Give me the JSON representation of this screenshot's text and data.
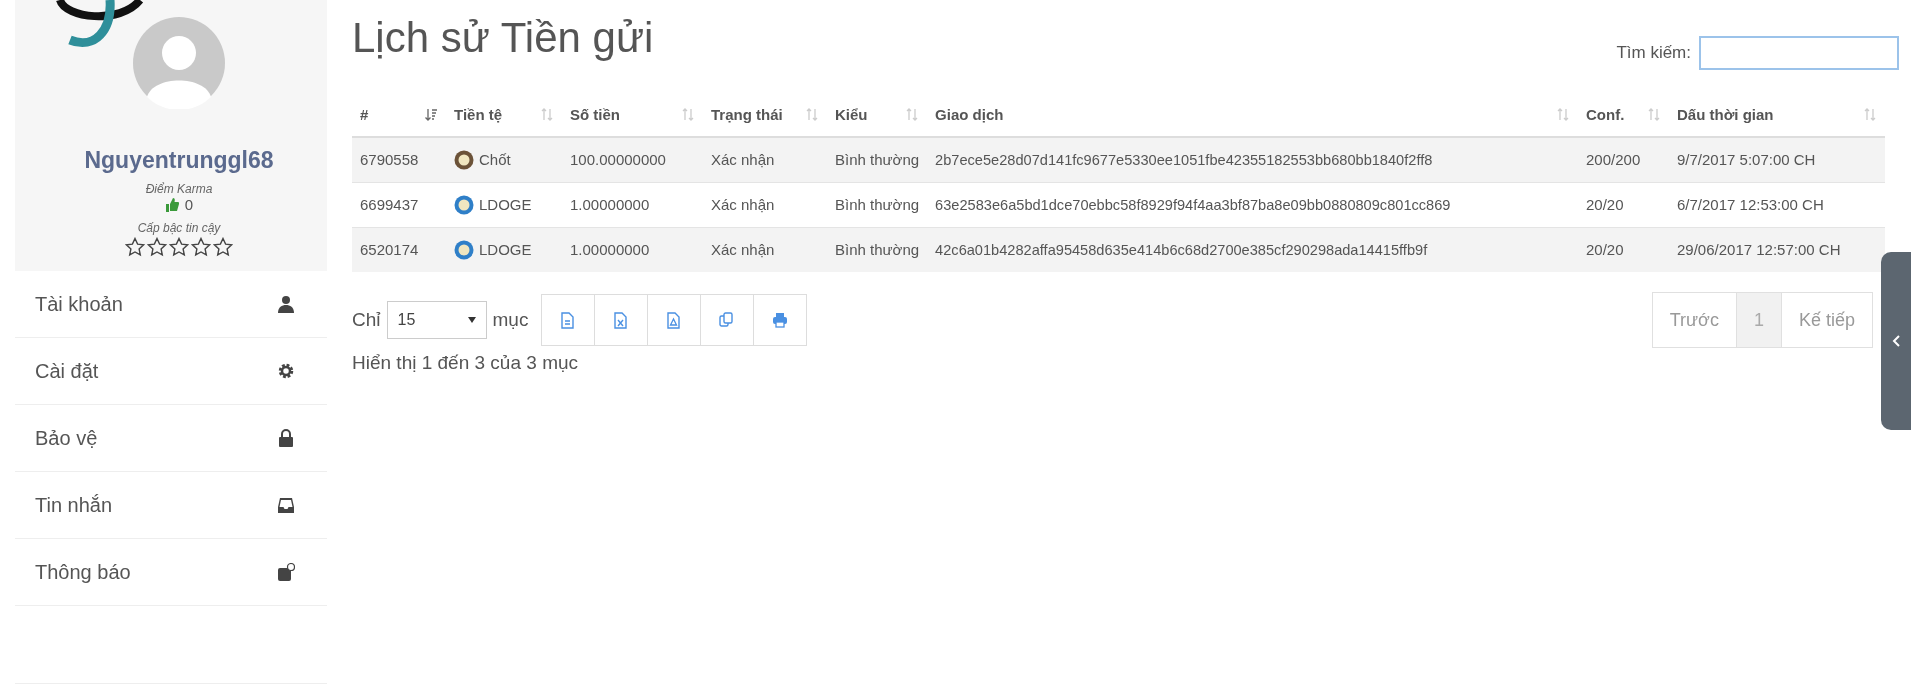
{
  "profile": {
    "username": "Nguyentrunggl68",
    "karma_label": "Điểm Karma",
    "karma_value": "0",
    "trust_label": "Cấp bậc tin cậy",
    "stars": 0
  },
  "sidebar": {
    "items": [
      {
        "label": "Tài khoản",
        "kind": "user"
      },
      {
        "label": "Cài đặt",
        "kind": "gear"
      },
      {
        "label": "Bảo vệ",
        "kind": "lock"
      },
      {
        "label": "Tin nhắn",
        "kind": "inbox"
      },
      {
        "label": "Thông báo",
        "kind": "bell"
      }
    ]
  },
  "page_title": "Lịch sử Tiền gửi",
  "search": {
    "label": "Tìm kiếm:"
  },
  "table": {
    "columns": [
      {
        "label": "#",
        "sorted": true
      },
      {
        "label": "Tiền tệ",
        "sorted": false
      },
      {
        "label": "Số tiền",
        "sorted": false
      },
      {
        "label": "Trạng thái",
        "sorted": false
      },
      {
        "label": "Kiểu",
        "sorted": false
      },
      {
        "label": "Giao dịch",
        "sorted": false
      },
      {
        "label": "Conf.",
        "sorted": false
      },
      {
        "label": "Dấu thời gian",
        "sorted": false
      }
    ],
    "rows": [
      {
        "id": "6790558",
        "currency": "Chốt",
        "color": "#6b5238",
        "amount": "100.00000000",
        "status": "Xác nhận",
        "type": "Bình thường",
        "tx": "2b7ece5e28d07d141fc9677e5330ee1051fbe42355182553bb680bb1840f2ff8",
        "conf": "200/200",
        "time": "9/7/2017 5:07:00 CH"
      },
      {
        "id": "6699437",
        "currency": "LDOGE",
        "color": "#2f7fc8",
        "amount": "1.00000000",
        "status": "Xác nhận",
        "type": "Bình thường",
        "tx": "63e2583e6a5bd1dce70ebbc58f8929f94f4aa3bf87ba8e09bb0880809c801cc869",
        "conf": "20/20",
        "time": "6/7/2017 12:53:00 CH"
      },
      {
        "id": "6520174",
        "currency": "LDOGE",
        "color": "#2f7fc8",
        "amount": "1.00000000",
        "status": "Xác nhận",
        "type": "Bình thường",
        "tx": "42c6a01b4282affa95458d635e414b6c68d2700e385cf290298ada14415ffb9f",
        "conf": "20/20",
        "time": "29/06/2017 12:57:00 CH"
      }
    ]
  },
  "length": {
    "prefix": "Chỉ",
    "value": "15",
    "suffix": "mục"
  },
  "info": "Hiển thị 1 đến 3 của 3 mục",
  "pagination": [
    {
      "label": "Trước",
      "selected": false
    },
    {
      "label": "1",
      "selected": true
    },
    {
      "label": "Kế tiếp",
      "selected": false
    }
  ]
}
